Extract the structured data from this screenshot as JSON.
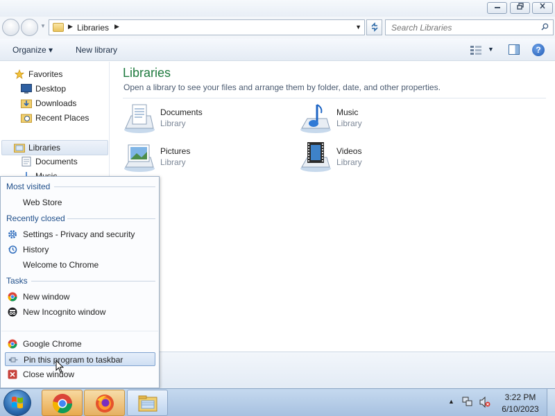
{
  "window": {
    "minimize_icon": "minimize-icon",
    "maximize_icon": "restore-icon",
    "close_icon": "close-icon",
    "close_color": "#c7413a"
  },
  "address": {
    "path": "Libraries",
    "search_placeholder": "Search Libraries"
  },
  "toolbar": {
    "organize_label": "Organize ▾",
    "new_library_label": "New library"
  },
  "nav": {
    "favorites": "Favorites",
    "desktop": "Desktop",
    "downloads": "Downloads",
    "recent_places": "Recent Places",
    "libraries": "Libraries",
    "documents": "Documents",
    "music": "Music"
  },
  "content": {
    "title": "Libraries",
    "description": "Open a library to see your files and arrange them by folder, date, and other properties.",
    "libraries": [
      {
        "name": "Documents",
        "type": "Library",
        "icon": "documents-library-icon"
      },
      {
        "name": "Music",
        "type": "Library",
        "icon": "music-library-icon"
      },
      {
        "name": "Pictures",
        "type": "Library",
        "icon": "pictures-library-icon"
      },
      {
        "name": "Videos",
        "type": "Library",
        "icon": "videos-library-icon"
      }
    ]
  },
  "jumplist": {
    "most_visited_header": "Most visited",
    "most_visited": [
      "Web Store"
    ],
    "recently_closed_header": "Recently closed",
    "recently_closed": [
      {
        "label": "Settings - Privacy and security",
        "icon": "gear-icon"
      },
      {
        "label": "History",
        "icon": "history-icon"
      },
      {
        "label": "Welcome to Chrome",
        "icon": ""
      }
    ],
    "tasks_header": "Tasks",
    "tasks": [
      {
        "label": "New window",
        "icon": "chrome-icon"
      },
      {
        "label": "New Incognito window",
        "icon": "incognito-icon"
      }
    ],
    "app_name": "Google Chrome",
    "pin_label": "Pin this program to taskbar",
    "close_label": "Close window"
  },
  "taskbar": {
    "apps": [
      "chrome-icon",
      "firefox-icon",
      "folder-icon"
    ],
    "time": "3:22 PM",
    "date": "6/10/2023",
    "tray_expand": "▲"
  },
  "colors": {
    "library_title": "#1e7a3e",
    "jumplist_header": "#1e4e8a",
    "taskbar": "#b4cce8"
  }
}
